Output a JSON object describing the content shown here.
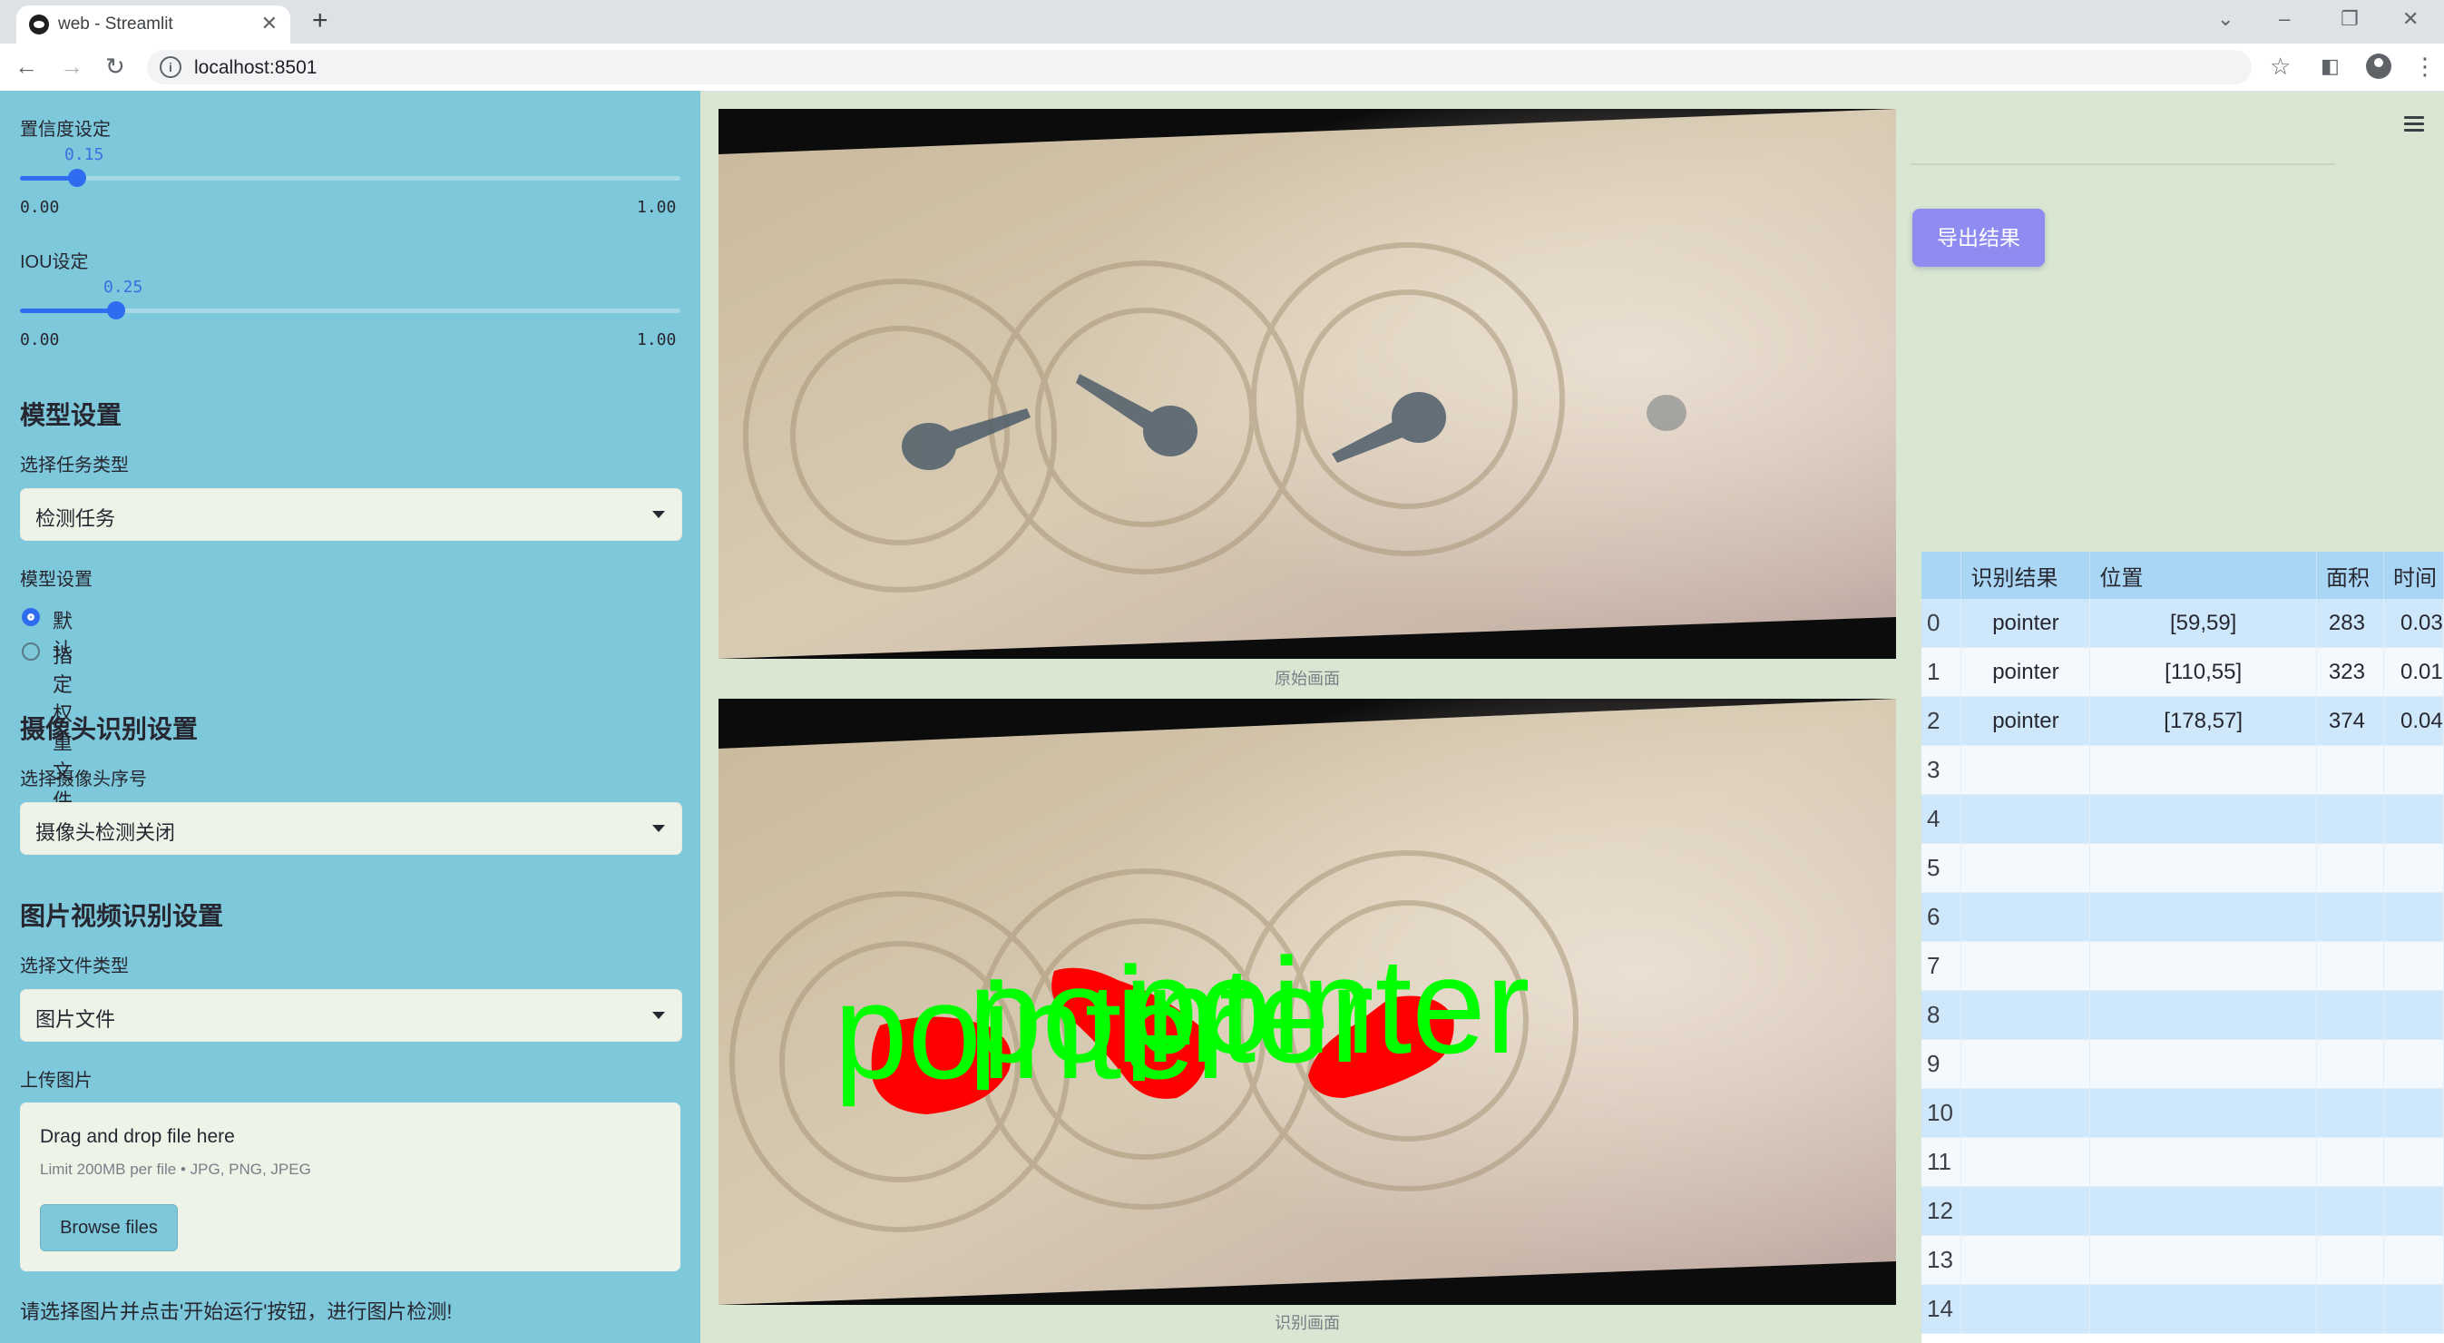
{
  "browser": {
    "tab_title": "web - Streamlit",
    "url": "localhost:8501"
  },
  "sidebar": {
    "conf_label": "置信度设定",
    "conf_value": "0.15",
    "conf_level": 0.15,
    "conf_min": "0.00",
    "conf_max": "1.00",
    "iou_label": "IOU设定",
    "iou_value": "0.25",
    "iou_level": 0.25,
    "iou_min": "0.00",
    "iou_max": "1.00",
    "model_header": "模型设置",
    "task_type_label": "选择任务类型",
    "task_type_value": "检测任务",
    "model_setting_label": "模型设置",
    "radio_default": "默认",
    "radio_custom": "指定权重文件",
    "camera_header": "摄像头识别设置",
    "camera_select_label": "选择摄像头序号",
    "camera_select_value": "摄像头检测关闭",
    "media_header": "图片视频识别设置",
    "file_type_label": "选择文件类型",
    "file_type_value": "图片文件",
    "upload_label": "上传图片",
    "drop_text": "Drag and drop file here",
    "limit_text": "Limit 200MB per file • JPG, PNG, JPEG",
    "browse_label": "Browse files",
    "hint_text": "请选择图片并点击'开始运行'按钮，进行图片检测!"
  },
  "main": {
    "original_caption": "原始画面",
    "result_caption": "识别画面",
    "detection_label": "pointer"
  },
  "right": {
    "export_label": "导出结果",
    "table": {
      "headers": [
        "",
        "识别结果",
        "位置",
        "面积",
        "时间"
      ],
      "rows": [
        [
          "0",
          "pointer",
          "[59,59]",
          "283",
          "0.03"
        ],
        [
          "1",
          "pointer",
          "[110,55]",
          "323",
          "0.01"
        ],
        [
          "2",
          "pointer",
          "[178,57]",
          "374",
          "0.04"
        ],
        [
          "3",
          "",
          "",
          "",
          ""
        ],
        [
          "4",
          "",
          "",
          "",
          ""
        ],
        [
          "5",
          "",
          "",
          "",
          ""
        ],
        [
          "6",
          "",
          "",
          "",
          ""
        ],
        [
          "7",
          "",
          "",
          "",
          ""
        ],
        [
          "8",
          "",
          "",
          "",
          ""
        ],
        [
          "9",
          "",
          "",
          "",
          ""
        ],
        [
          "10",
          "",
          "",
          "",
          ""
        ],
        [
          "11",
          "",
          "",
          "",
          ""
        ],
        [
          "12",
          "",
          "",
          "",
          ""
        ],
        [
          "13",
          "",
          "",
          "",
          ""
        ],
        [
          "14",
          "",
          "",
          "",
          ""
        ]
      ]
    }
  },
  "colors": {
    "sidebar_bg": "#7ec8dc",
    "accent": "#2f6df0",
    "export_btn": "#8e8cf0",
    "table_header": "#a9d6f5",
    "detection_mask": "#ff0000",
    "detection_text": "#00ff00"
  }
}
